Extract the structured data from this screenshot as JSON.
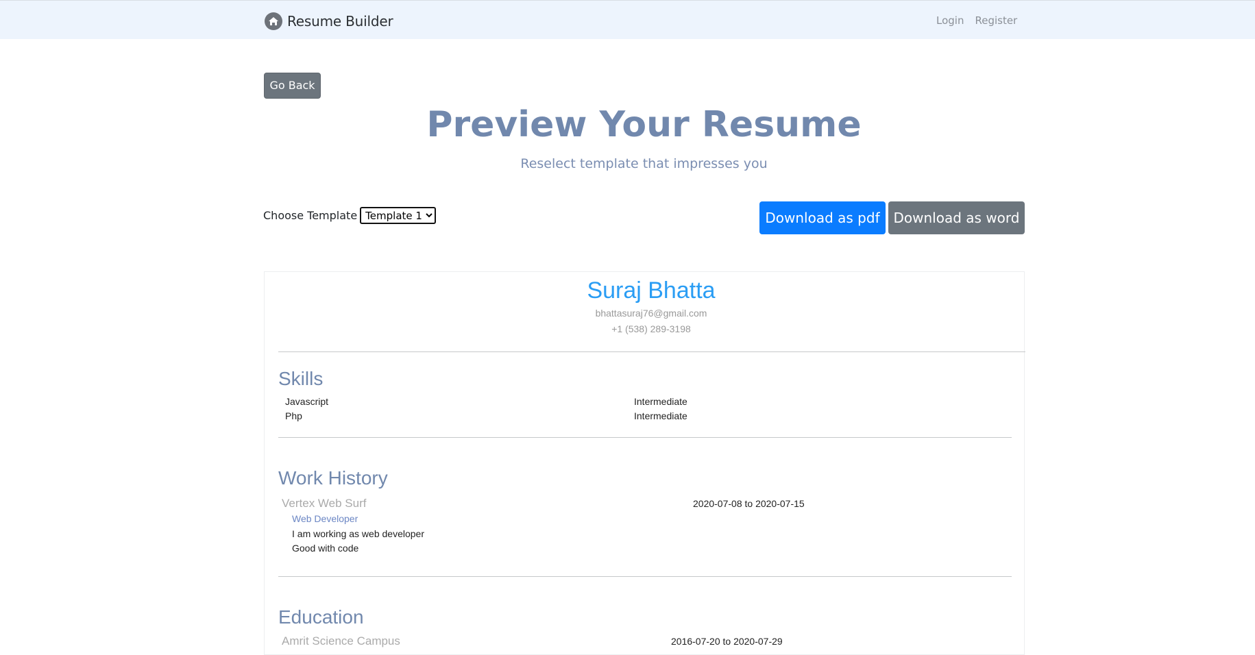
{
  "navbar": {
    "brand_icon": "home-icon",
    "brand": "Resume Builder",
    "links": [
      "Login",
      "Register"
    ]
  },
  "actions": {
    "go_back": "Go Back",
    "download_pdf": "Download as pdf",
    "download_word": "Download as word"
  },
  "header": {
    "title": "Preview Your Resume",
    "subtitle": "Reselect template that impresses you"
  },
  "template_select": {
    "label": "Choose Template",
    "selected": "Template 1"
  },
  "resume": {
    "name": "Suraj Bhatta",
    "email": "bhattasuraj76@gmail.com",
    "phone": "+1 (538) 289-3198",
    "skills_title": "Skills",
    "skills": [
      {
        "name": "Javascript",
        "level": "Intermediate"
      },
      {
        "name": "Php",
        "level": "Intermediate"
      }
    ],
    "work_title": "Work History",
    "work": {
      "company": "Vertex Web Surf",
      "dates": "2020-07-08 to 2020-07-15",
      "role": "Web Developer",
      "lines": [
        "I am working as web developer",
        "Good with code"
      ]
    },
    "education_title": "Education",
    "education": {
      "school": "Amrit Science Campus",
      "dates": "2016-07-20 to 2020-07-29"
    }
  },
  "colors": {
    "navbar_bg": "#edf4fd",
    "accent_blue": "#0a7cff",
    "secondary_gray": "#6c757d",
    "title_color": "#7188ad",
    "name_color": "#2a9df4"
  }
}
